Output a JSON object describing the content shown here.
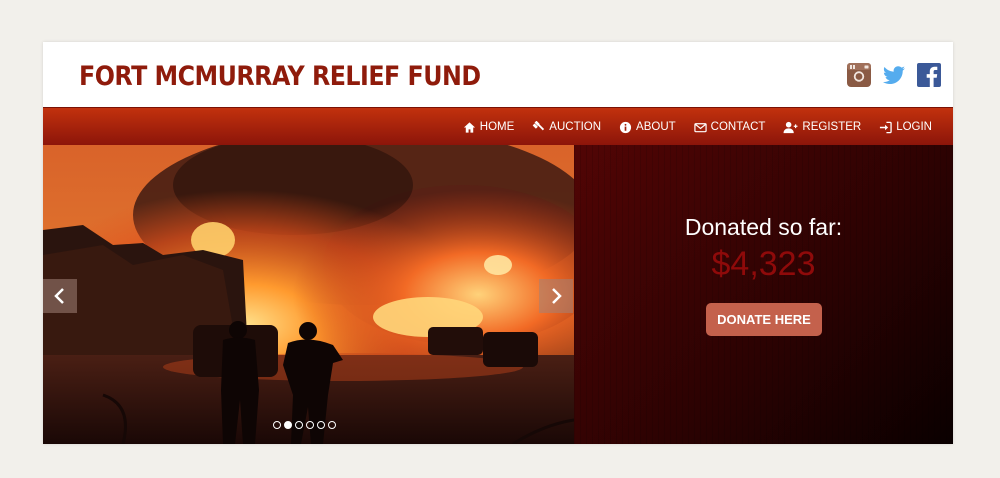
{
  "site": {
    "logo_text": "FORT MCMURRAY RELIEF FUND",
    "brand_color": "#8f1b0b"
  },
  "social": [
    {
      "name": "instagram-icon",
      "color": "#8a5a44"
    },
    {
      "name": "twitter-icon",
      "color": "#55acee"
    },
    {
      "name": "facebook-icon",
      "color": "#3b5998"
    }
  ],
  "nav": {
    "items": [
      {
        "label": "HOME",
        "icon": "home-icon"
      },
      {
        "label": "AUCTION",
        "icon": "gavel-icon"
      },
      {
        "label": "ABOUT",
        "icon": "info-icon"
      },
      {
        "label": "CONTACT",
        "icon": "envelope-icon"
      },
      {
        "label": "REGISTER",
        "icon": "user-plus-icon"
      },
      {
        "label": "LOGIN",
        "icon": "sign-in-icon"
      }
    ]
  },
  "slider": {
    "prev_icon": "chevron-left-icon",
    "next_icon": "chevron-right-icon",
    "slide_count": 6,
    "active_index": 1
  },
  "donation": {
    "label": "Donated so far:",
    "amount": "$4,323",
    "button_label": "DONATE HERE"
  }
}
